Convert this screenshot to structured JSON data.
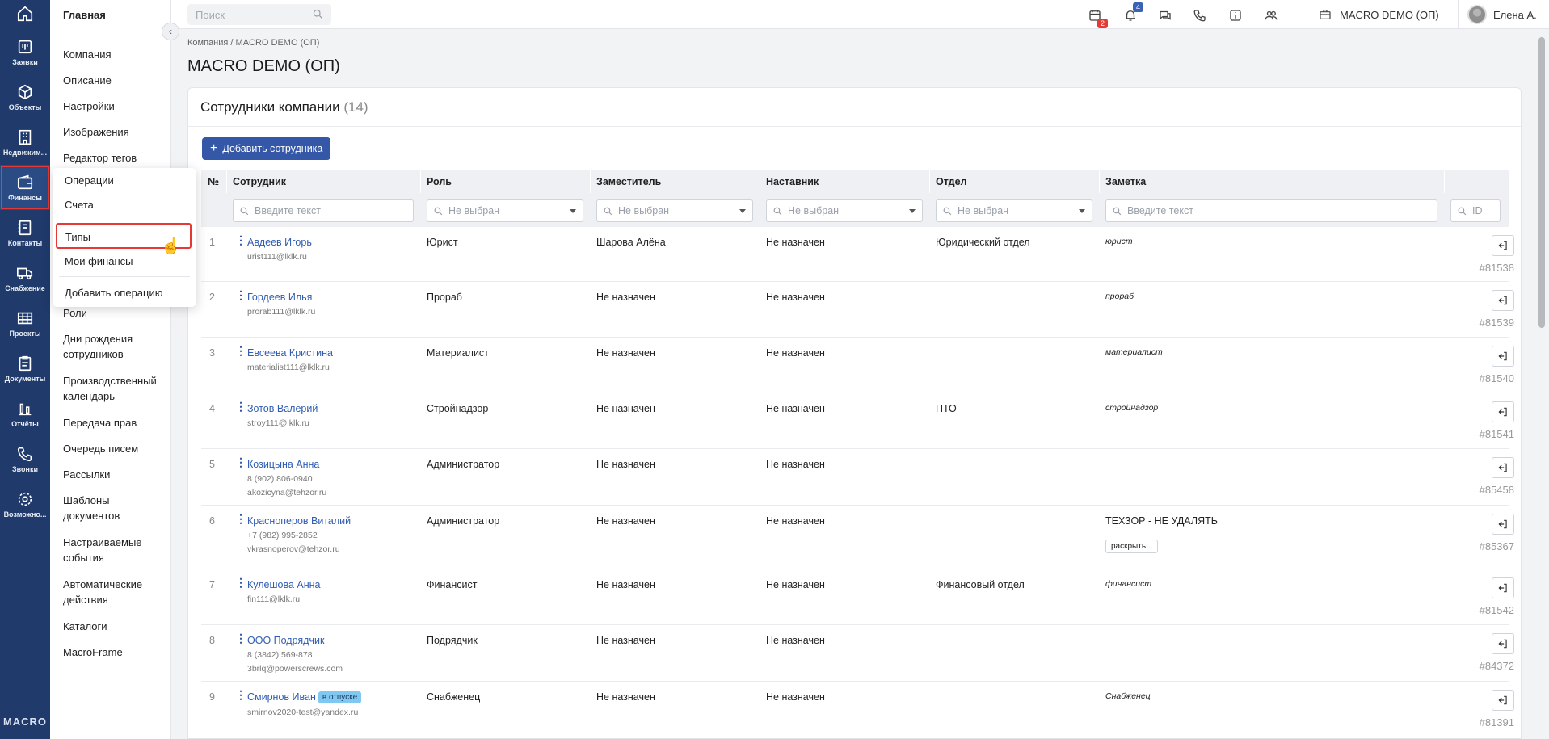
{
  "rail": {
    "items": [
      {
        "label": "",
        "icon": "home-icon"
      },
      {
        "label": "Заявки",
        "icon": "requests-icon"
      },
      {
        "label": "Объекты",
        "icon": "cube-icon"
      },
      {
        "label": "Недвижим...",
        "icon": "building-icon"
      },
      {
        "label": "Финансы",
        "icon": "wallet-icon"
      },
      {
        "label": "Контакты",
        "icon": "contacts-icon"
      },
      {
        "label": "Снабжение",
        "icon": "truck-icon"
      },
      {
        "label": "Проекты",
        "icon": "projects-icon"
      },
      {
        "label": "Документы",
        "icon": "document-icon"
      },
      {
        "label": "Отчёты",
        "icon": "reports-icon"
      },
      {
        "label": "Звонки",
        "icon": "phone-icon"
      },
      {
        "label": "Возможно...",
        "icon": "gear-icon"
      }
    ],
    "brand": "MACRO"
  },
  "submenu": {
    "title": "Главная",
    "items": [
      "Компания",
      "Описание",
      "Настройки",
      "Изображения",
      "Редактор тегов",
      "Роли",
      "Дни рождения сотрудников",
      "Производственный календарь",
      "Передача прав",
      "Очередь писем",
      "Рассылки",
      "Шаблоны документов",
      "Настраиваемые события",
      "Автоматические действия",
      "Каталоги",
      "MacroFrame"
    ]
  },
  "flyout": {
    "items": [
      "Операции",
      "Счета",
      "Типы",
      "Мои финансы",
      "Добавить операцию"
    ],
    "selected": "Типы"
  },
  "topbar": {
    "search_placeholder": "Поиск",
    "calendar_badge": "2",
    "notifications_badge": "4",
    "company": "MACRO DEMO (ОП)",
    "user": "Елена А."
  },
  "breadcrumb": {
    "root": "Компания",
    "separator": "/",
    "current": "MACRO DEMO (ОП)"
  },
  "page_title": "MACRO DEMO (ОП)",
  "section": {
    "title": "Сотрудники компании",
    "count": "(14)",
    "add_button": "Добавить сотрудника"
  },
  "table": {
    "headers": [
      "№",
      "Сотрудник",
      "Роль",
      "Заместитель",
      "Наставник",
      "Отдел",
      "Заметка"
    ],
    "filters": {
      "employee": "Введите текст",
      "role": "Не выбран",
      "deputy": "Не выбран",
      "mentor": "Не выбран",
      "dept": "Не выбран",
      "note": "Введите текст",
      "id": "ID"
    },
    "rows": [
      {
        "n": "1",
        "name": "Авдеев Игорь",
        "line2": "urist111@lklk.ru",
        "line3": "",
        "badge": "",
        "role": "Юрист",
        "deputy": "Шарова Алёна",
        "mentor": "Не назначен",
        "dept": "Юридический отдел",
        "note": "юрист",
        "note_style": "italic",
        "id": "#81538"
      },
      {
        "n": "2",
        "name": "Гордеев Илья",
        "line2": "prorab111@lklk.ru",
        "line3": "",
        "badge": "",
        "role": "Прораб",
        "deputy": "Не назначен",
        "mentor": "Не назначен",
        "dept": "",
        "note": "прораб",
        "note_style": "italic",
        "id": "#81539"
      },
      {
        "n": "3",
        "name": "Евсеева Кристина",
        "line2": "materialist111@lklk.ru",
        "line3": "",
        "badge": "",
        "role": "Материалист",
        "deputy": "Не назначен",
        "mentor": "Не назначен",
        "dept": "",
        "note": "материалист",
        "note_style": "italic",
        "id": "#81540"
      },
      {
        "n": "4",
        "name": "Зотов Валерий",
        "line2": "stroy111@lklk.ru",
        "line3": "",
        "badge": "",
        "role": "Стройнадзор",
        "deputy": "Не назначен",
        "mentor": "Не назначен",
        "dept": "ПТО",
        "note": "стройнадзор",
        "note_style": "italic",
        "id": "#81541"
      },
      {
        "n": "5",
        "name": "Козицына Анна",
        "line2": "8 (902) 806-0940",
        "line3": "akozicyna@tehzor.ru",
        "badge": "",
        "role": "Администратор",
        "deputy": "Не назначен",
        "mentor": "Не назначен",
        "dept": "",
        "note": "",
        "note_style": "italic",
        "id": "#85458"
      },
      {
        "n": "6",
        "name": "Красноперов Виталий",
        "line2": "+7 (982) 995-2852",
        "line3": "vkrasnoperov@tehzor.ru",
        "badge": "",
        "role": "Администратор",
        "deputy": "Не назначен",
        "mentor": "Не назначен",
        "dept": "",
        "note": "ТЕХЗОР - НЕ УДАЛЯТЬ",
        "note_style": "normal",
        "expand": "раскрыть...",
        "id": "#85367"
      },
      {
        "n": "7",
        "name": "Кулешова Анна",
        "line2": "fin111@lklk.ru",
        "line3": "",
        "badge": "",
        "role": "Финансист",
        "deputy": "Не назначен",
        "mentor": "Не назначен",
        "dept": "Финансовый отдел",
        "note": "финансист",
        "note_style": "italic",
        "id": "#81542"
      },
      {
        "n": "8",
        "name": "ООО Подрядчик",
        "line2": "8 (3842) 569-878",
        "line3": "3brlq@powerscrews.com",
        "badge": "",
        "role": "Подрядчик",
        "deputy": "Не назначен",
        "mentor": "Не назначен",
        "dept": "",
        "note": "",
        "note_style": "italic",
        "id": "#84372"
      },
      {
        "n": "9",
        "name": "Смирнов Иван",
        "line2": "smirnov2020-test@yandex.ru",
        "line3": "",
        "badge": "в отпуске",
        "role": "Снабженец",
        "deputy": "Не назначен",
        "mentor": "Не назначен",
        "dept": "",
        "note": "Снабженец",
        "note_style": "italic",
        "id": "#81391"
      }
    ]
  },
  "colors": {
    "rail": "#1f3a6b",
    "accent": "#3557a7",
    "link": "#2f5db3",
    "highlight": "#e53935",
    "vacation_badge": "#7fc8f2"
  }
}
